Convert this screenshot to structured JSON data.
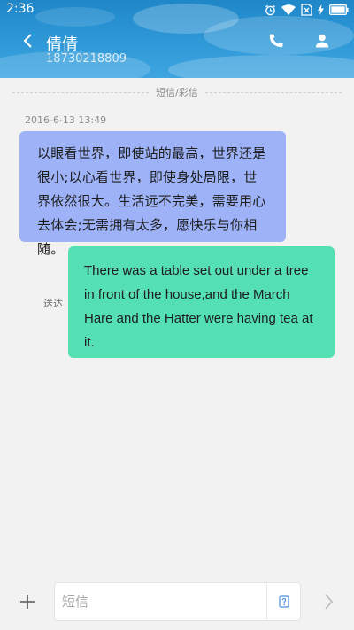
{
  "status_bar": {
    "time": "2:36"
  },
  "header": {
    "contact_name": "倩倩",
    "contact_number": "18730218809",
    "back_icon": "back-arrow-icon",
    "call_icon": "phone-icon",
    "contact_icon": "person-icon"
  },
  "conversation": {
    "divider_label": "短信/彩信",
    "timestamp": "2016-6-13 13:49",
    "messages": [
      {
        "direction": "incoming",
        "text": "以眼看世界，即使站的最高，世界还是很小;以心看世界，即使身处局限，世界依然很大。生活远不完美，需要用心去体会;无需拥有太多，愿快乐与你相随。",
        "color": "#9db2f7"
      },
      {
        "direction": "outgoing",
        "text": "There was a table set out under a tree in front of the house,and the March Hare and the Hatter were having tea at it.",
        "status": "送达",
        "color": "#55e0b4"
      }
    ]
  },
  "composer": {
    "placeholder": "短信",
    "value": "",
    "add_icon": "plus-icon",
    "sms_type_icon": "sms-type-icon",
    "send_icon": "send-chevron-icon"
  },
  "colors": {
    "header": "#2f99d8",
    "background": "#f2f2f2"
  }
}
